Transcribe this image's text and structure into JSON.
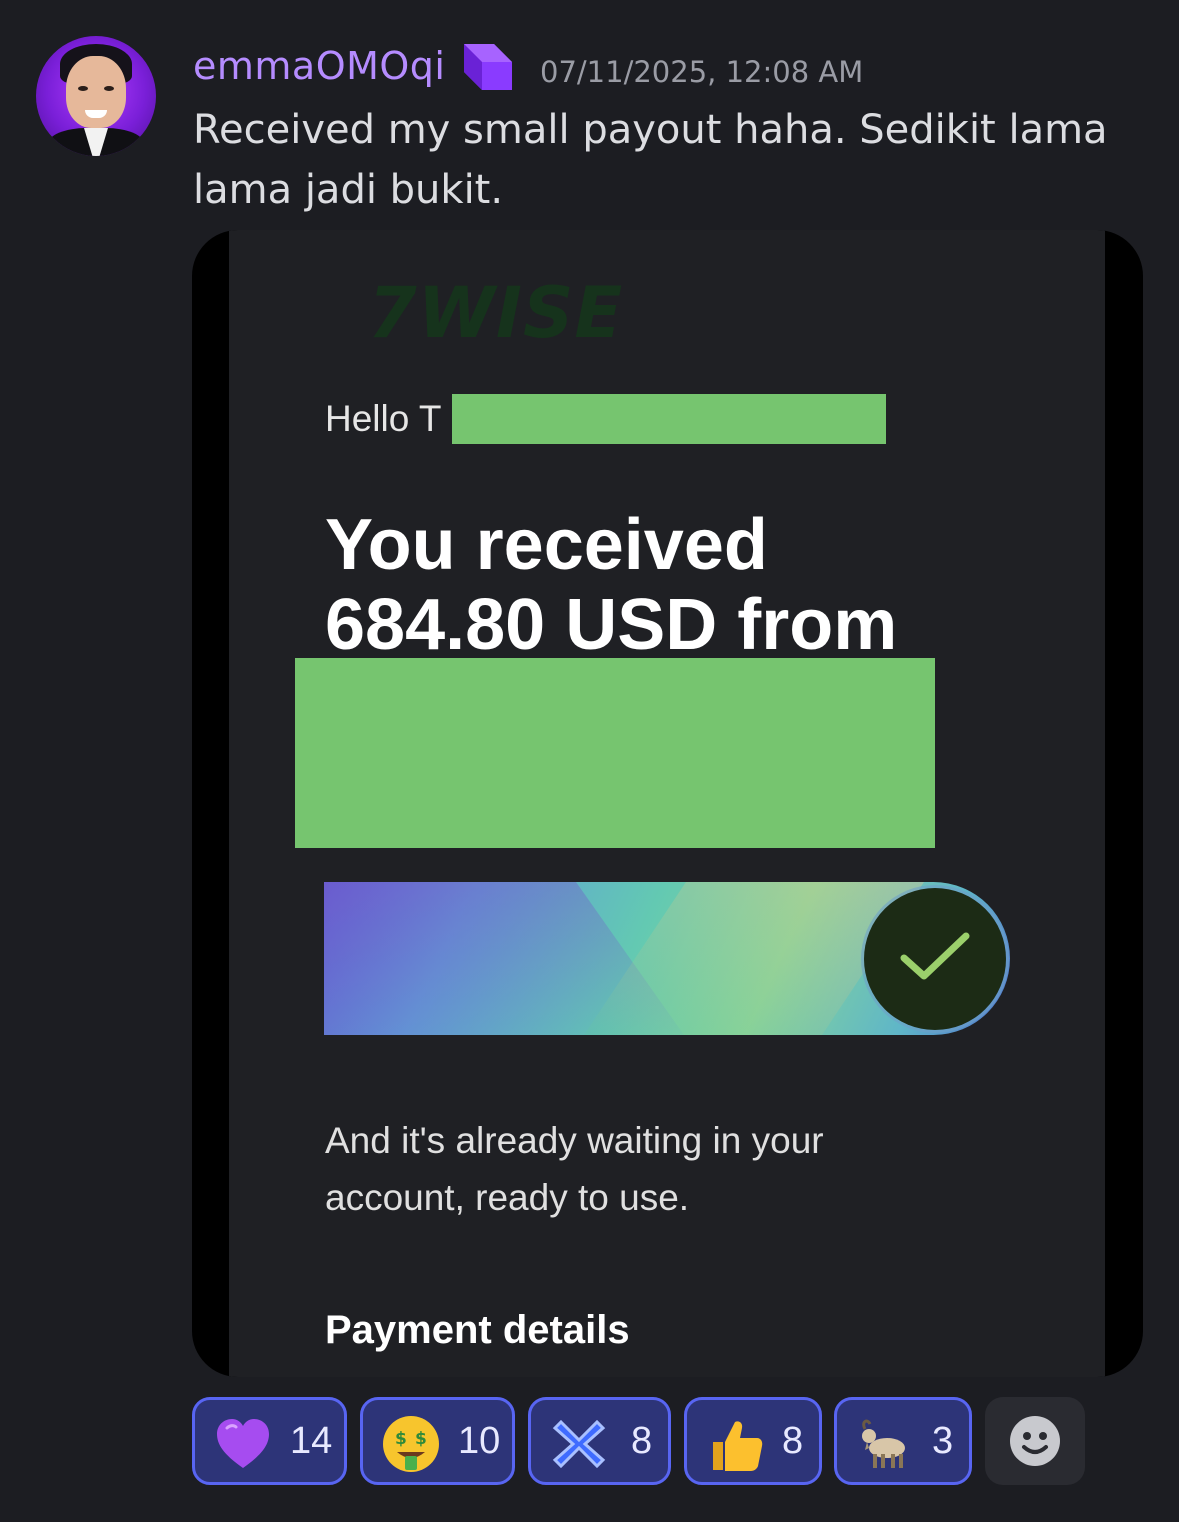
{
  "message": {
    "author": "emmaOMOqi",
    "timestamp": "07/11/2025, 12:08 AM",
    "text": "Received my small payout haha. Sedikit lama lama jadi bukit.",
    "avatar_icon": "user-avatar",
    "badge_icon": "purple-cube-badge-icon"
  },
  "attachment": {
    "brand": "7WISE",
    "greeting": "Hello T",
    "headline": "You received 684.80 USD from",
    "body": "And it's already waiting in your account, ready to use.",
    "section_title": "Payment details",
    "redaction_color": "#76c56f",
    "check_icon": "checkmark-icon"
  },
  "reactions": [
    {
      "emoji": "purple-heart-icon",
      "count": "14"
    },
    {
      "emoji": "money-mouth-face-icon",
      "count": "10"
    },
    {
      "emoji": "blue-x-logo-icon",
      "count": "8"
    },
    {
      "emoji": "thumbs-up-icon",
      "count": "8"
    },
    {
      "emoji": "goat-icon",
      "count": "3"
    }
  ],
  "add_reaction_icon": "add-reaction-smiley-icon",
  "colors": {
    "background": "#1c1d22",
    "username": "#b58cff",
    "reaction_bg": "#2d3478",
    "reaction_border": "#5865f2"
  }
}
